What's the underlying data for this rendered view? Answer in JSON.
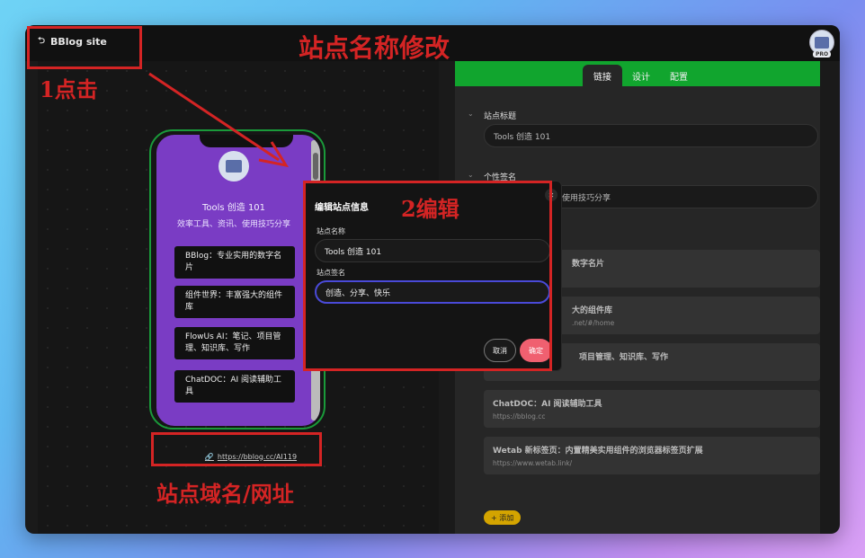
{
  "topbar": {
    "back_label": "BBlog site",
    "back_icon": "back-arrow-icon",
    "pro_badge": "PRO"
  },
  "preview": {
    "site_name": "Tools 创造 101",
    "site_signature": "效率工具、资讯、使用技巧分享",
    "links": [
      "BBlog：专业实用的数字名片",
      "组件世界：丰富强大的组件库",
      "FlowUs AI：笔记、项目管理、知识库、写作",
      "ChatDOC：AI 阅读辅助工具"
    ],
    "url": "https://bblog.cc/AI119"
  },
  "config": {
    "tabs": [
      "链接",
      "设计",
      "配置"
    ],
    "active_tab": "链接",
    "title_label": "站点标题",
    "title_value": "Tools 创造 101",
    "sig_label": "个性签名",
    "sig_value_visible": "使用技巧分享",
    "cards": [
      {
        "title": "数字名片",
        "url": ""
      },
      {
        "title": "大的组件库",
        "url": ".net/#/home"
      },
      {
        "title": "项目管理、知识库、写作",
        "url": ""
      },
      {
        "title": "ChatDOC：AI 阅读辅助工具",
        "url": "https://bblog.cc"
      },
      {
        "title": "Wetab 新标签页：内置精美实用组件的浏览器标签页扩展",
        "url": "https://www.wetab.link/"
      }
    ],
    "add_label": "+ 添加"
  },
  "dialog": {
    "title": "编辑站点信息",
    "name_label": "站点名称",
    "name_value": "Tools 创造 101",
    "sig_label": "站点签名",
    "sig_value": "创造、分享、快乐",
    "cancel_label": "取消",
    "ok_label": "确定",
    "close_icon": "close-icon"
  },
  "annotations": {
    "top_title": "站点名称修改",
    "step1": "1点击",
    "step2": "2编辑",
    "bottom": "站点域名/网址"
  },
  "colors": {
    "accent_green": "#11a52e",
    "phone_purple": "#7a3cc4",
    "annotation_red": "#d42424",
    "ok_pink": "#f06070"
  }
}
